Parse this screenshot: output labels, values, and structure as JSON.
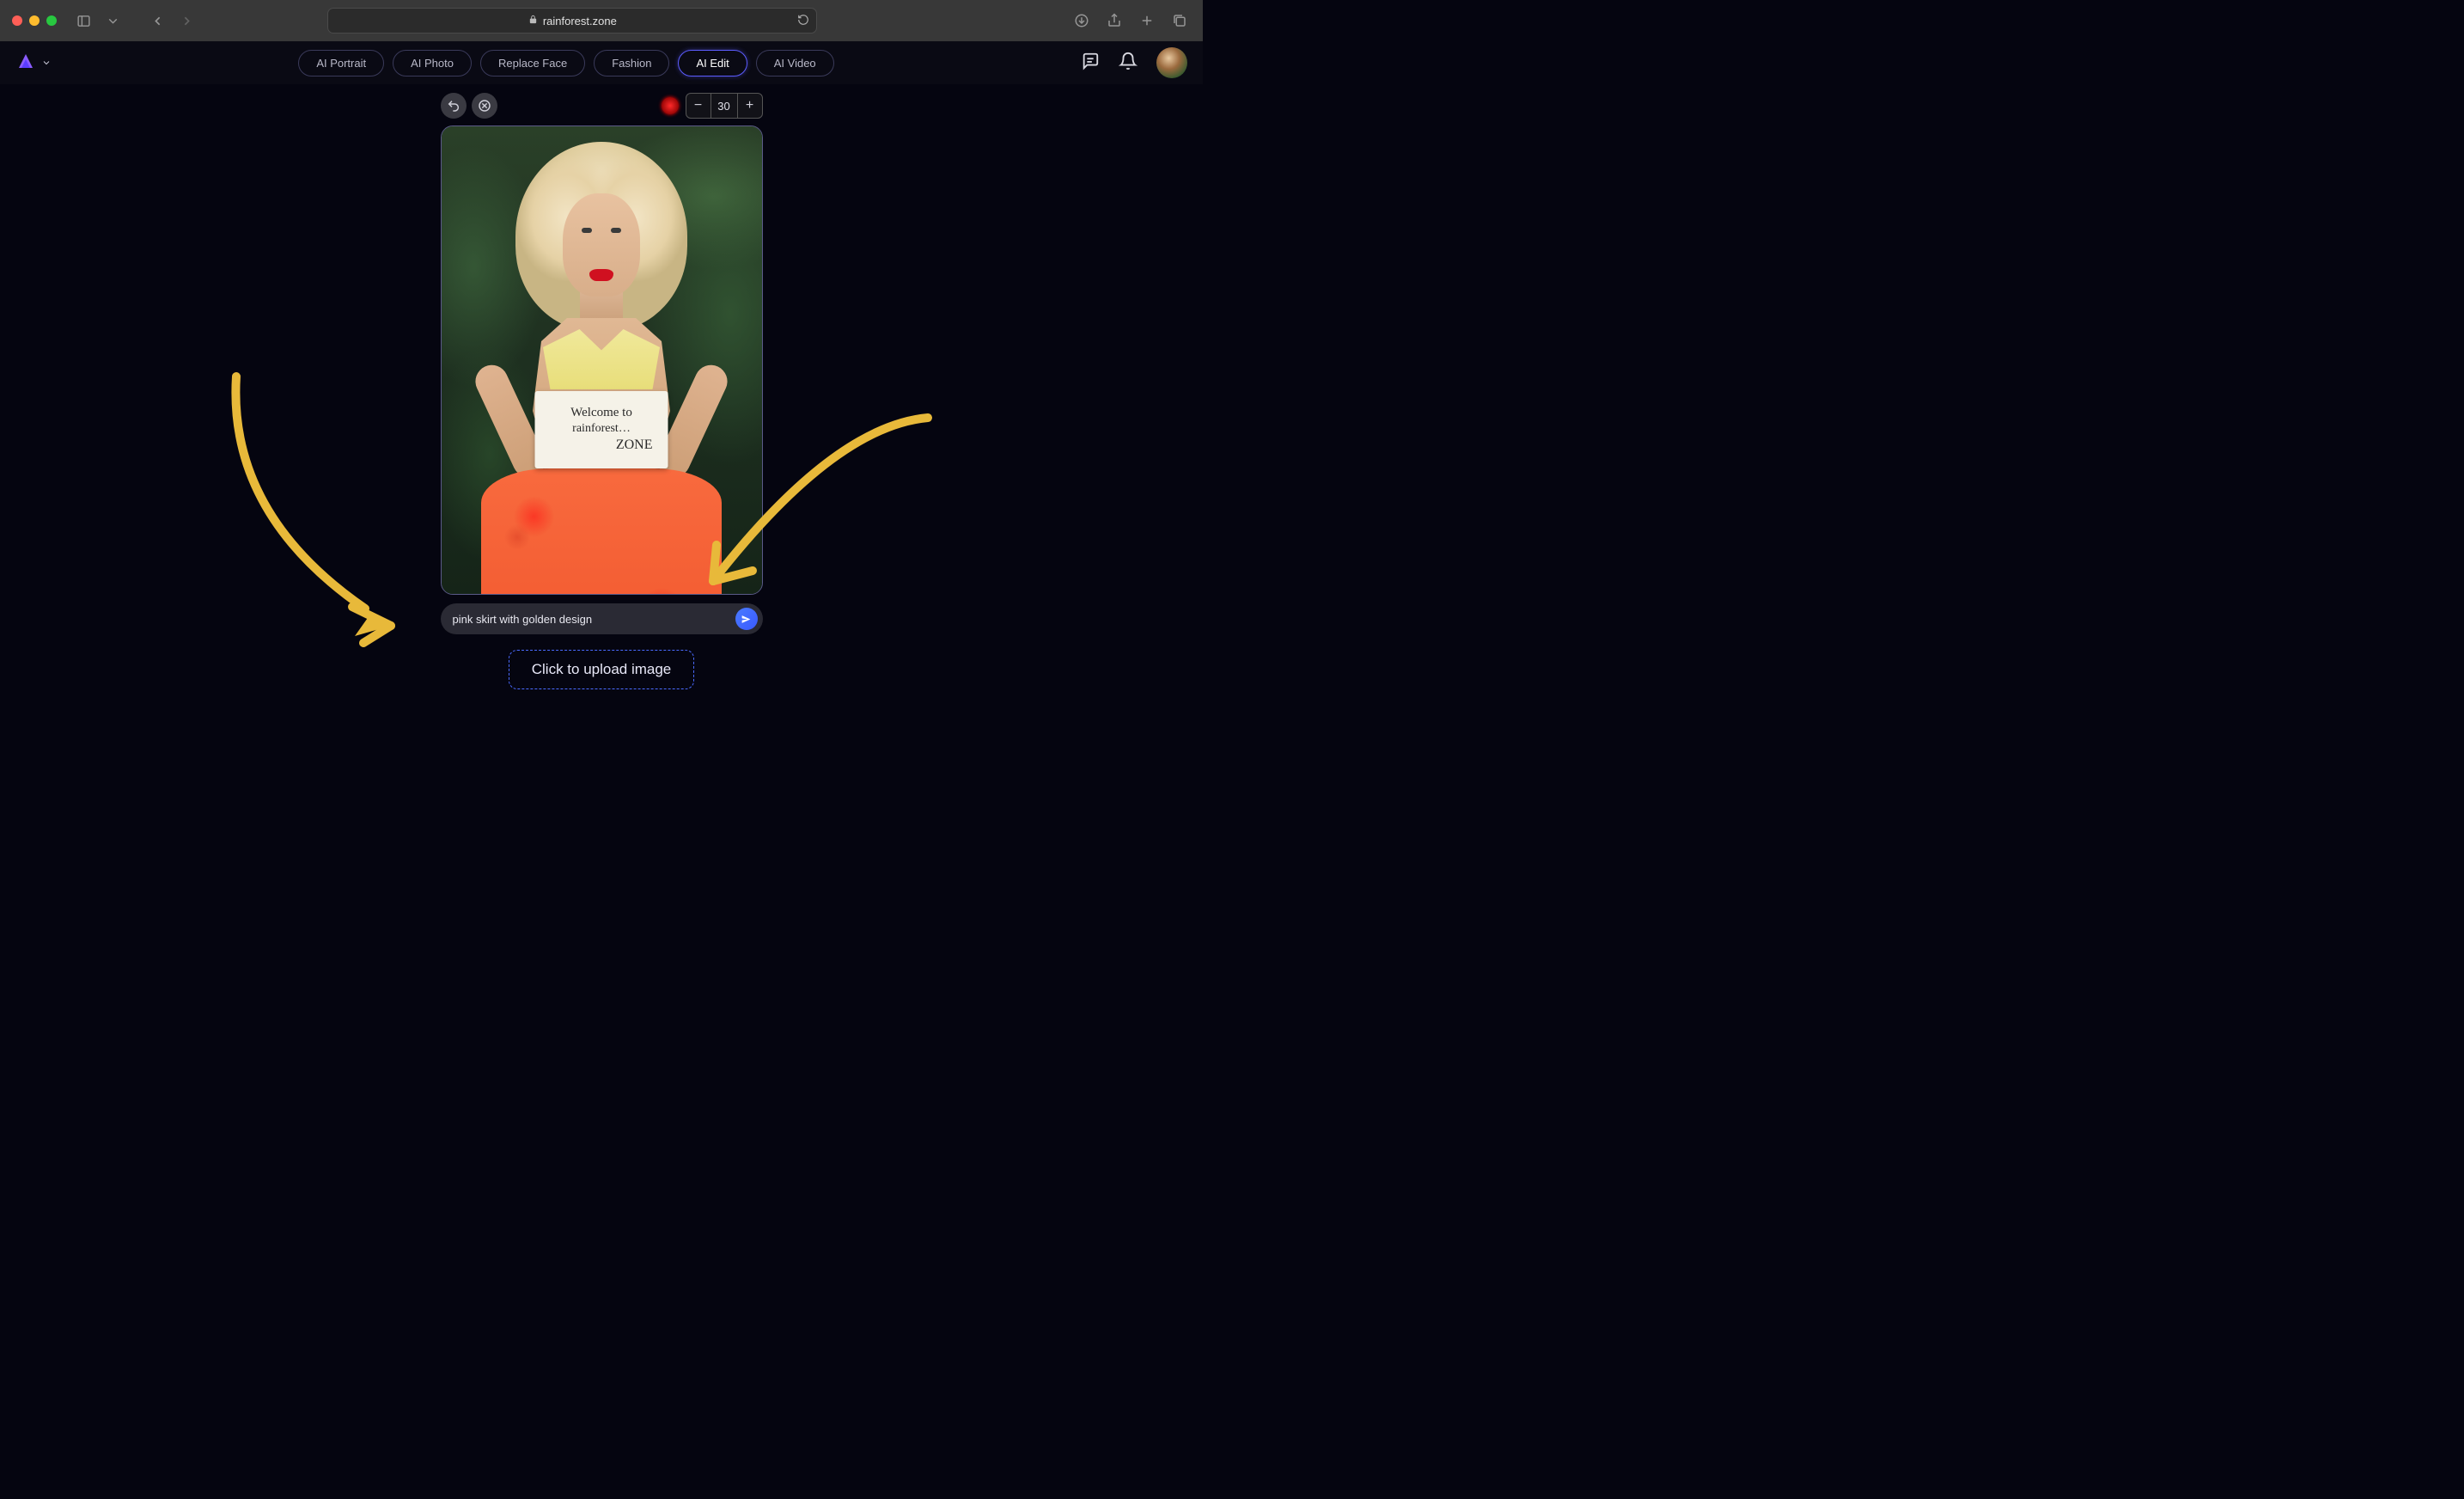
{
  "browser": {
    "url_display": "rainforest.zone"
  },
  "nav": {
    "tabs": [
      {
        "label": "AI Portrait",
        "active": false
      },
      {
        "label": "AI Photo",
        "active": false
      },
      {
        "label": "Replace Face",
        "active": false
      },
      {
        "label": "Fashion",
        "active": false
      },
      {
        "label": "AI Edit",
        "active": true
      },
      {
        "label": "AI Video",
        "active": false
      }
    ]
  },
  "editor": {
    "brush_size": "30",
    "minus": "−",
    "plus": "+",
    "sign_line1": "Welcome to",
    "sign_line2": "rainforest…",
    "sign_line3": "ZONE"
  },
  "prompt": {
    "value": "pink skirt with golden design"
  },
  "upload": {
    "label": "Click to upload image"
  }
}
